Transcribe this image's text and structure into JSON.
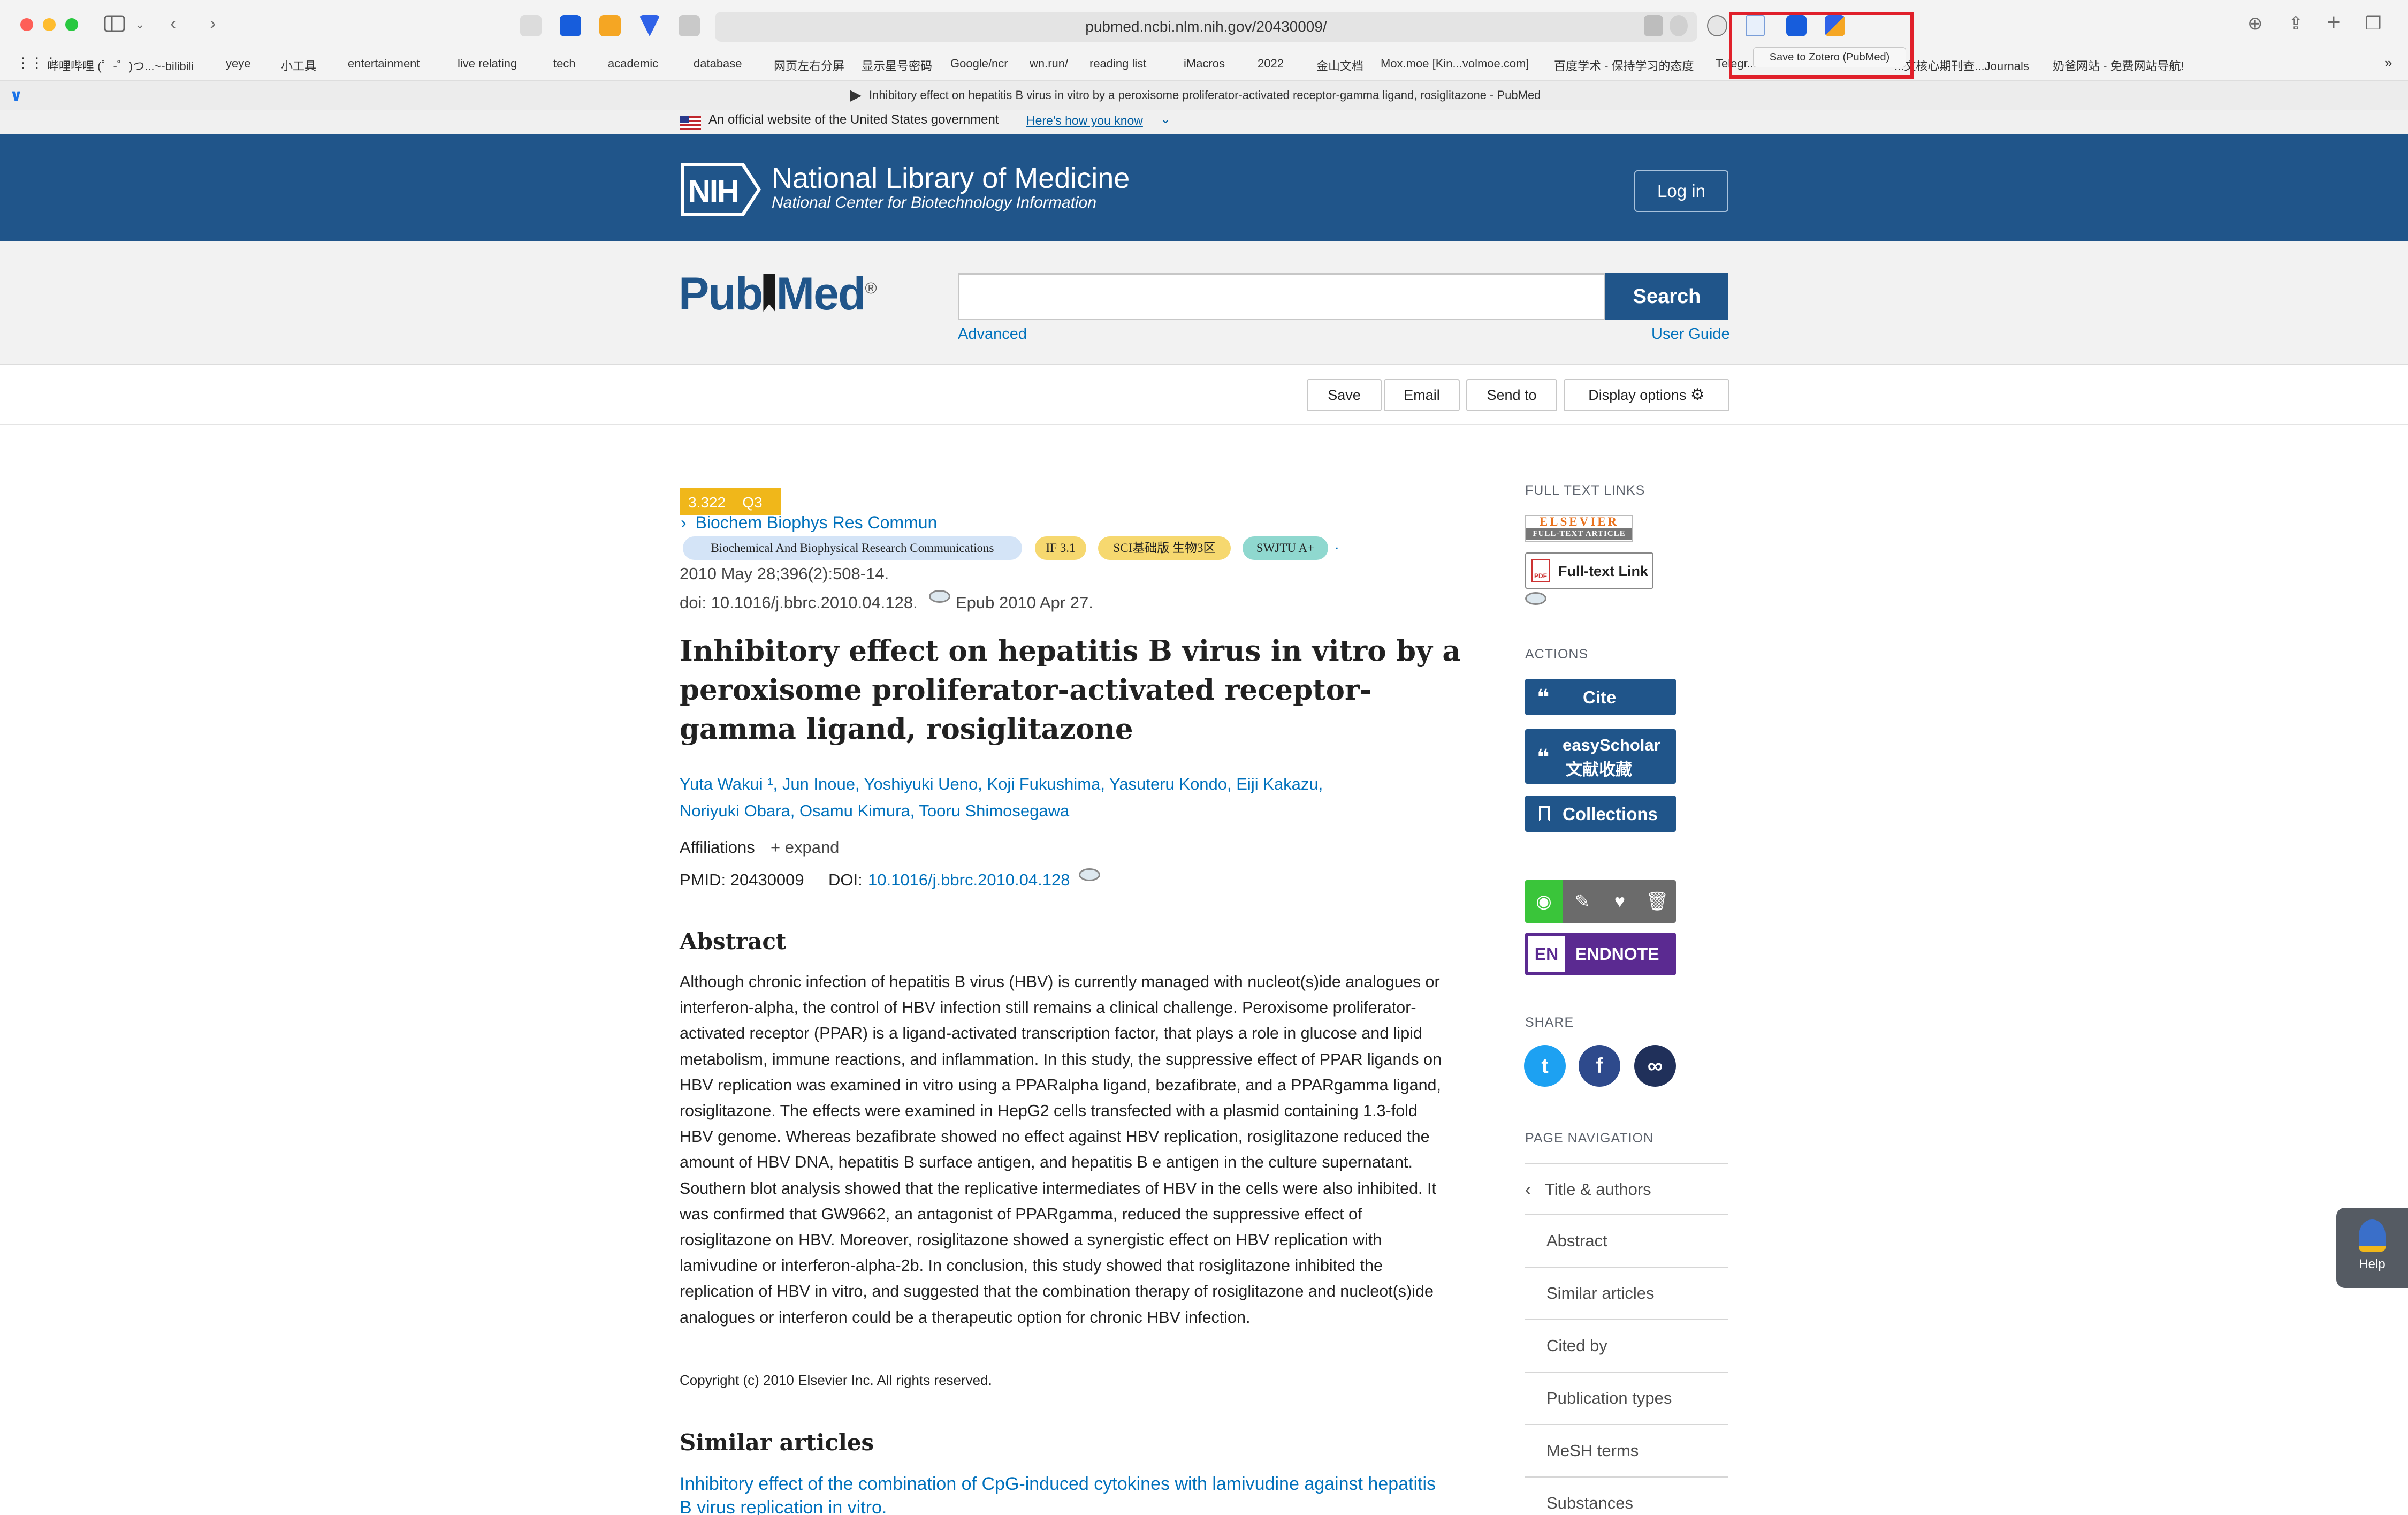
{
  "browser": {
    "url": "pubmed.ncbi.nlm.nih.gov/20430009/",
    "tab_title": "Inhibitory effect on hepatitis B virus in vitro by a peroxisome proliferator-activated receptor-gamma ligand, rosiglitazone - PubMed",
    "zotero_tooltip": "Save to Zotero (PubMed)",
    "bookmarks": [
      "哔哩哔哩 (゜-゜)つ...~-bilibili",
      "yeye",
      "小工具",
      "entertainment",
      "live relating",
      "tech",
      "academic",
      "database",
      "网页左右分屏",
      "显示星号密码",
      "Google/ncr",
      "wn.run/",
      "reading list",
      "iMacros",
      "2022",
      "金山文档",
      "Mox.moe [Kin...volmoe.com]",
      "百度学术 - 保持学习的态度",
      "Telegr...",
      "...文核心期刊查...Journals",
      "奶爸网站 - 免费网站导航!"
    ]
  },
  "gov_banner": {
    "text": "An official website of the United States government",
    "link": "Here's how you know"
  },
  "header": {
    "logo": "NIH",
    "title": "National Library of Medicine",
    "subtitle": "National Center for Biotechnology Information",
    "login": "Log in"
  },
  "search": {
    "logo_pub": "Pub",
    "logo_med": "Med",
    "placeholder": "",
    "button": "Search",
    "advanced": "Advanced",
    "user_guide": "User Guide"
  },
  "actions_bar": {
    "save": "Save",
    "email": "Email",
    "send_to": "Send to",
    "display_options": "Display options"
  },
  "article": {
    "impact": "3.322",
    "quartile": "Q3",
    "journal": "Biochem Biophys Res Commun",
    "tags": {
      "full_name": "Biochemical And Biophysical Research Communications",
      "if": "IF 3.1",
      "sci": "SCI基础版 生物3区",
      "swjtu": "SWJTU A+"
    },
    "date": "2010 May 28;396(2):508-14.",
    "doi_line": "doi: 10.1016/j.bbrc.2010.04.128.",
    "epub": "Epub 2010 Apr 27.",
    "title": "Inhibitory effect on hepatitis B virus in vitro by a peroxisome proliferator-activated receptor-gamma ligand, rosiglitazone",
    "authors_line1": "Yuta Wakui ¹, Jun Inoue, Yoshiyuki Ueno, Koji Fukushima, Yasuteru Kondo, Eiji Kakazu,",
    "authors_line2": "Noriyuki Obara, Osamu Kimura, Tooru Shimosegawa",
    "affiliations": "Affiliations",
    "expand": "+ expand",
    "pmid": "PMID: 20430009",
    "doi_label": "DOI:",
    "doi": "10.1016/j.bbrc.2010.04.128",
    "abstract_heading": "Abstract",
    "abstract": "Although chronic infection of hepatitis B virus (HBV) is currently managed with nucleot(s)ide analogues or interferon-alpha, the control of HBV infection still remains a clinical challenge. Peroxisome proliferator-activated receptor (PPAR) is a ligand-activated transcription factor, that plays a role in glucose and lipid metabolism, immune reactions, and inflammation. In this study, the suppressive effect of PPAR ligands on HBV replication was examined in vitro using a PPARalpha ligand, bezafibrate, and a PPARgamma ligand, rosiglitazone. The effects were examined in HepG2 cells transfected with a plasmid containing 1.3-fold HBV genome. Whereas bezafibrate showed no effect against HBV replication, rosiglitazone reduced the amount of HBV DNA, hepatitis B surface antigen, and hepatitis B e antigen in the culture supernatant. Southern blot analysis showed that the replicative intermediates of HBV in the cells were also inhibited. It was confirmed that GW9662, an antagonist of PPARgamma, reduced the suppressive effect of rosiglitazone on HBV. Moreover, rosiglitazone showed a synergistic effect on HBV replication with lamivudine or interferon-alpha-2b. In conclusion, this study showed that rosiglitazone inhibited the replication of HBV in vitro, and suggested that the combination therapy of rosiglitazone and nucleot(s)ide analogues or interferon could be a therapeutic option for chronic HBV infection.",
    "copyright": "Copyright (c) 2010 Elsevier Inc. All rights reserved.",
    "similar_heading": "Similar articles",
    "similar_first": "Inhibitory effect of the combination of CpG-induced cytokines with lamivudine against hepatitis B virus replication in vitro."
  },
  "sidebar": {
    "full_text_heading": "FULL TEXT LINKS",
    "elsevier": "ELSEVIER",
    "elsevier_sub": "FULL-TEXT ARTICLE",
    "fulltext_link": "Full-text Link",
    "actions_heading": "ACTIONS",
    "cite": "Cite",
    "easyscholar_1": "easyScholar",
    "easyscholar_2": "文献收藏",
    "collections": "Collections",
    "endnote": "ENDNOTE",
    "endnote_badge": "EN",
    "share_heading": "SHARE",
    "nav_heading": "PAGE NAVIGATION",
    "nav": [
      "Title & authors",
      "Abstract",
      "Similar articles",
      "Cited by",
      "Publication types",
      "MeSH terms",
      "Substances"
    ],
    "help": "Help"
  },
  "colors": {
    "nih_blue": "#20558a",
    "link": "#0071bc",
    "highlight_red": "#e0202a",
    "endnote_purple": "#5b2a91"
  }
}
